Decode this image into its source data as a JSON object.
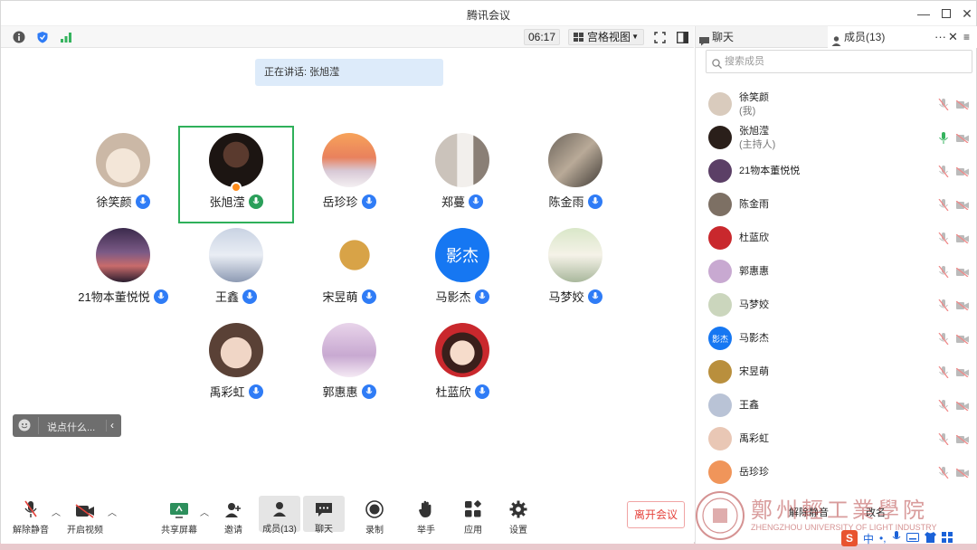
{
  "window": {
    "title": "腾讯会议"
  },
  "toolbar": {
    "clock": "06:17",
    "view_label": "宫格视图"
  },
  "stage": {
    "speaking_prefix": "正在讲话: ",
    "speaking_name": "张旭滢"
  },
  "tiles": [
    {
      "name": "徐笑颜",
      "mic": "blue"
    },
    {
      "name": "张旭滢",
      "mic": "green",
      "active": true
    },
    {
      "name": "岳珍珍",
      "mic": "blue"
    },
    {
      "name": "郑蔓",
      "mic": "blue"
    },
    {
      "name": "陈金雨",
      "mic": "blue"
    },
    {
      "name": "21物本董悦悦",
      "mic": "blue"
    },
    {
      "name": "王鑫",
      "mic": "blue"
    },
    {
      "name": "宋昱萌",
      "mic": "blue"
    },
    {
      "name": "马影杰",
      "mic": "blue",
      "avatar_text": "影杰"
    },
    {
      "name": "马梦姣",
      "mic": "blue"
    },
    {
      "name": "禹彩虹",
      "mic": "blue"
    },
    {
      "name": "郭惠惠",
      "mic": "blue"
    },
    {
      "name": "杜蓝欣",
      "mic": "blue"
    }
  ],
  "chat_input": {
    "placeholder": "说点什么..."
  },
  "bottom": {
    "unmute": "解除静音",
    "video": "开启视频",
    "share": "共享屏幕",
    "invite": "邀请",
    "members": "成员(13)",
    "chat": "聊天",
    "record": "录制",
    "raise": "举手",
    "apps": "应用",
    "settings": "设置",
    "leave": "离开会议"
  },
  "panel": {
    "tab_chat": "聊天",
    "tab_members": "成员(13)",
    "search_placeholder": "搜索成员",
    "members": [
      {
        "name": "徐笑颜",
        "sub": "(我)"
      },
      {
        "name": "张旭滢",
        "sub": "(主持人)",
        "speaking": true
      },
      {
        "name": "21物本董悦悦"
      },
      {
        "name": "陈金雨"
      },
      {
        "name": "杜蓝欣"
      },
      {
        "name": "郭惠惠"
      },
      {
        "name": "马梦姣"
      },
      {
        "name": "马影杰",
        "avatar_text": "影杰"
      },
      {
        "name": "宋昱萌"
      },
      {
        "name": "王鑫"
      },
      {
        "name": "禹彩虹"
      },
      {
        "name": "岳珍珍"
      }
    ],
    "unmute_all": "解除静音",
    "more": "改名"
  },
  "watermark": {
    "cn": "鄭州輕工業學院",
    "en": "ZHENGZHOU UNIVERSITY OF LIGHT INDUSTRY"
  },
  "colors": {
    "accent": "#2f7cf6",
    "active_green": "#2fb05a",
    "leave_red": "#e5433c"
  }
}
